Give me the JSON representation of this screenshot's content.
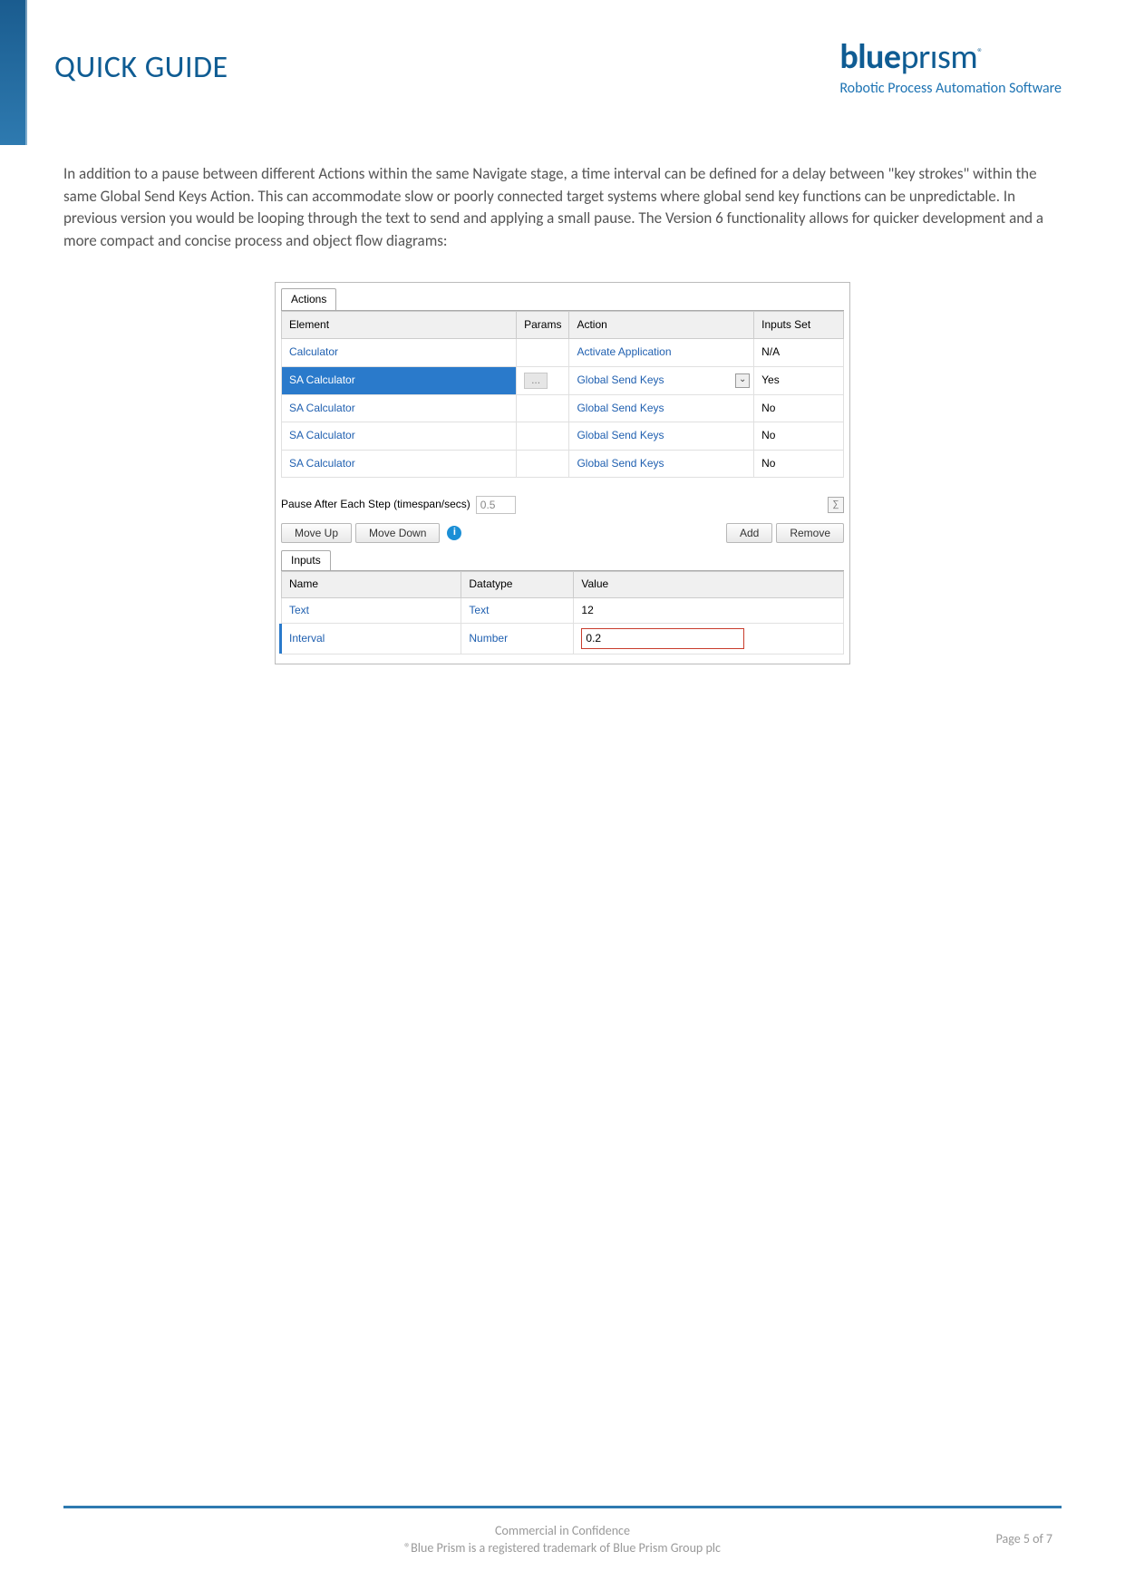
{
  "header": {
    "title": "QUICK GUIDE",
    "brand_bold": "blue",
    "brand_light": "prısm",
    "brand_ring": "®",
    "tagline": "Robotic Process Automation Software"
  },
  "paragraph": "In addition to a pause between different Actions within the same Navigate stage, a time interval can be defined for a delay between \"key strokes\" within the same Global Send Keys Action. This can accommodate slow or poorly connected target systems where global send key functions can be unpredictable. In previous version you would be looping through the text to send and applying a small pause. The Version 6 functionality allows for quicker development and a more compact and concise process and object flow diagrams:",
  "dialog": {
    "tab_actions": "Actions",
    "cols": {
      "element": "Element",
      "params": "Params",
      "action": "Action",
      "inputs_set": "Inputs Set"
    },
    "rows": [
      {
        "element": "Calculator",
        "params": "",
        "action": "Activate Application",
        "inputs_set": "N/A",
        "selected": false
      },
      {
        "element": "SA Calculator",
        "params": "...",
        "action": "Global Send Keys",
        "inputs_set": "Yes",
        "selected": true
      },
      {
        "element": "SA Calculator",
        "params": "",
        "action": "Global Send Keys",
        "inputs_set": "No",
        "selected": false
      },
      {
        "element": "SA Calculator",
        "params": "",
        "action": "Global Send Keys",
        "inputs_set": "No",
        "selected": false
      },
      {
        "element": "SA Calculator",
        "params": "",
        "action": "Global Send Keys",
        "inputs_set": "No",
        "selected": false
      }
    ],
    "pause_label": "Pause After Each Step (timespan/secs)",
    "pause_value": "0.5",
    "buttons": {
      "move_up": "Move Up",
      "move_down": "Move Down",
      "add": "Add",
      "remove": "Remove"
    },
    "inputs_tab": "Inputs",
    "inputs_cols": {
      "name": "Name",
      "datatype": "Datatype",
      "value": "Value"
    },
    "inputs_rows": [
      {
        "name": "Text",
        "datatype": "Text",
        "value": "12",
        "highlight": false
      },
      {
        "name": "Interval",
        "datatype": "Number",
        "value": "0.2",
        "highlight": true
      }
    ]
  },
  "footer": {
    "line1": "Commercial in Confidence",
    "line2": "®Blue Prism is a registered trademark of Blue Prism Group plc",
    "page": "Page 5 of 7"
  }
}
